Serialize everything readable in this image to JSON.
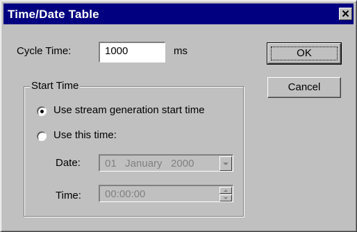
{
  "window": {
    "title": "Time/Date Table",
    "close_glyph": "✕"
  },
  "cycle_time": {
    "label": "Cycle Time:",
    "value": "1000",
    "unit": "ms"
  },
  "buttons": {
    "ok": "OK",
    "cancel": "Cancel"
  },
  "start_time": {
    "group_label": "Start Time",
    "option_stream": "Use stream generation start time",
    "option_this_time": "Use this time:",
    "selected": "option_stream",
    "date_label": "Date:",
    "date_value": "01   January   2000",
    "time_label": "Time:",
    "time_value": "00:00:00"
  },
  "colors": {
    "titlebar": "#000080",
    "face": "#c0c0c0",
    "disabled_text": "#808080"
  },
  "icons": {
    "close": "close-icon",
    "dropdown": "chevron-down-icon",
    "spin": "spinner-icon"
  }
}
